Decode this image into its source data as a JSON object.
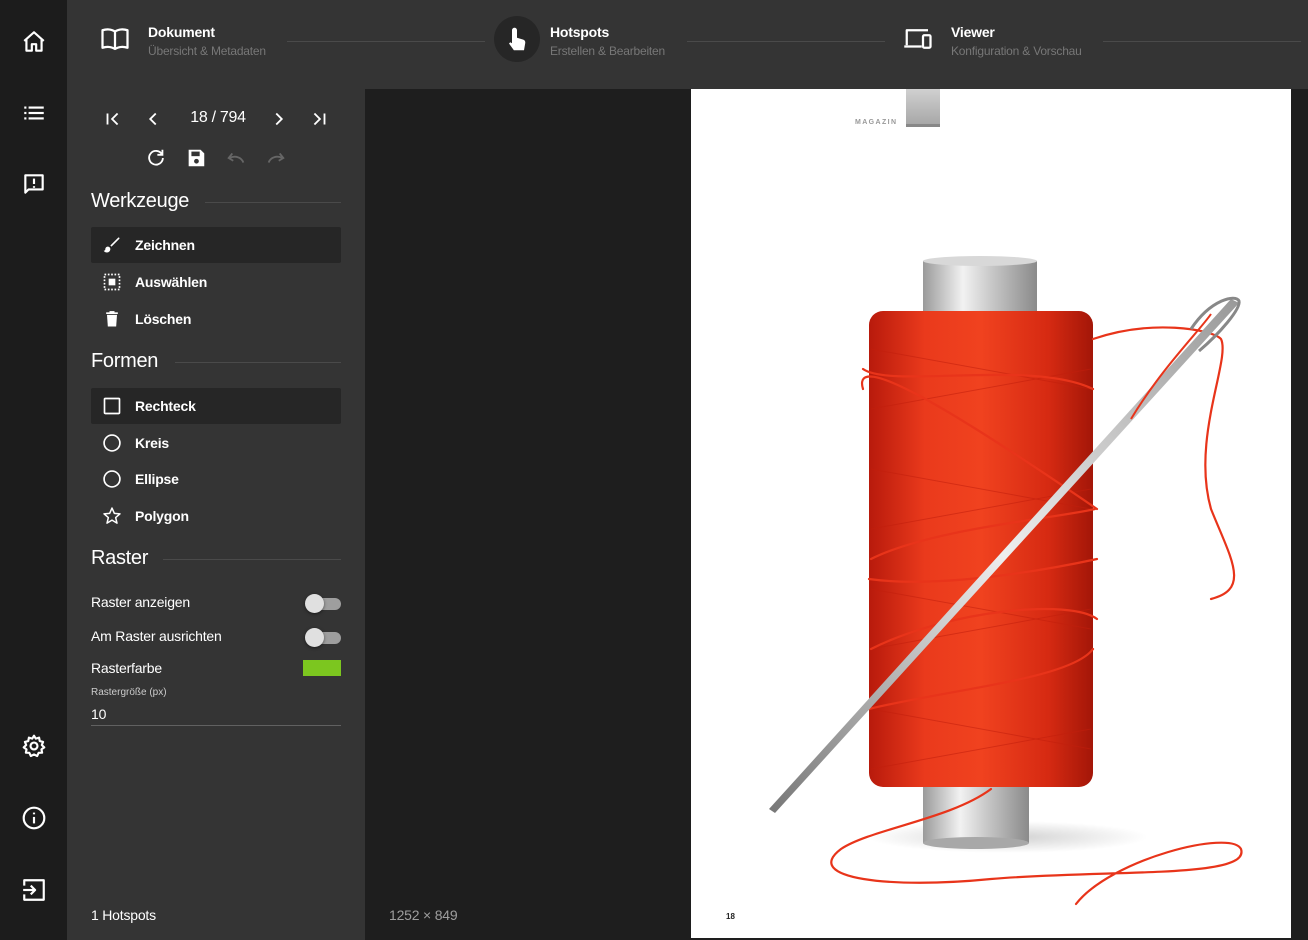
{
  "steps": [
    {
      "title": "Dokument",
      "subtitle": "Übersicht & Metadaten",
      "icon": "book-icon"
    },
    {
      "title": "Hotspots",
      "subtitle": "Erstellen & Bearbeiten",
      "icon": "touch-icon"
    },
    {
      "title": "Viewer",
      "subtitle": "Konfiguration & Vorschau",
      "icon": "devices-icon"
    }
  ],
  "rail": {
    "top_icons": [
      "home-icon",
      "list-icon",
      "feedback-icon"
    ],
    "bottom_icons": [
      "settings-icon",
      "info-icon",
      "logout-icon"
    ]
  },
  "pager": {
    "current": "18",
    "separator": "/",
    "total": "794",
    "label": "18 / 794"
  },
  "tools": {
    "title": "Werkzeuge",
    "items": [
      {
        "label": "Zeichnen",
        "icon": "brush-icon",
        "active": true
      },
      {
        "label": "Auswählen",
        "icon": "select-all-icon",
        "active": false
      },
      {
        "label": "Löschen",
        "icon": "trash-icon",
        "active": false
      }
    ]
  },
  "shapes": {
    "title": "Formen",
    "items": [
      {
        "label": "Rechteck",
        "icon": "square-icon",
        "active": true
      },
      {
        "label": "Kreis",
        "icon": "circle-icon",
        "active": false
      },
      {
        "label": "Ellipse",
        "icon": "circle-icon",
        "active": false
      },
      {
        "label": "Polygon",
        "icon": "star-icon",
        "active": false
      }
    ]
  },
  "grid": {
    "title": "Raster",
    "show_label": "Raster anzeigen",
    "show_value": false,
    "snap_label": "Am Raster ausrichten",
    "snap_value": false,
    "color_label": "Rasterfarbe",
    "color_value": "#7cc61f",
    "size_label": "Rastergröße (px)",
    "size_value": "10"
  },
  "footer": {
    "hotspots": "1 Hotspots",
    "dimensions": "1252 × 849"
  },
  "page": {
    "magazine_label": "MAGAZIN",
    "page_number": "18"
  },
  "colors": {
    "accent_grid": "#7cc61f",
    "thread": "#e8341a",
    "panel": "#343434",
    "rail": "#1c1c1c"
  }
}
